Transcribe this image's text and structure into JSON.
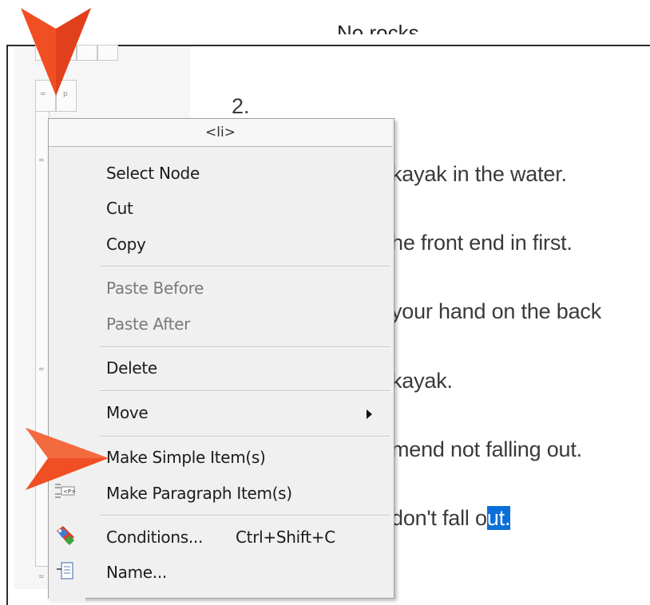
{
  "document": {
    "heading_fragment": "No rocks",
    "list_number": "2.",
    "lines": [
      {
        "text": "kayak in the water."
      },
      {
        "text": "he front end in first."
      },
      {
        "text": "your hand on the back"
      },
      {
        "text": "kayak."
      },
      {
        "text": "mend not falling out."
      },
      {
        "text_before": "don't fall o",
        "text_selected": "ut."
      }
    ]
  },
  "context_menu": {
    "header": "<li>",
    "items": {
      "select_node": "Select Node",
      "cut": "Cut",
      "copy": "Copy",
      "paste_before": "Paste Before",
      "paste_after": "Paste After",
      "delete": "Delete",
      "move": "Move",
      "make_simple_items": "Make Simple Item(s)",
      "make_paragraph_items": "Make Paragraph Item(s)",
      "conditions": "Conditions...",
      "conditions_shortcut": "Ctrl+Shift+C",
      "name": "Name..."
    },
    "icons": {
      "paragraph_item": "paragraph-item-icon",
      "conditions": "conditions-tag-icon",
      "name": "name-icon"
    }
  },
  "gutter": {
    "p_marker": "p"
  },
  "colors": {
    "callout": "#f04e23",
    "selection": "#0a6fd8"
  }
}
